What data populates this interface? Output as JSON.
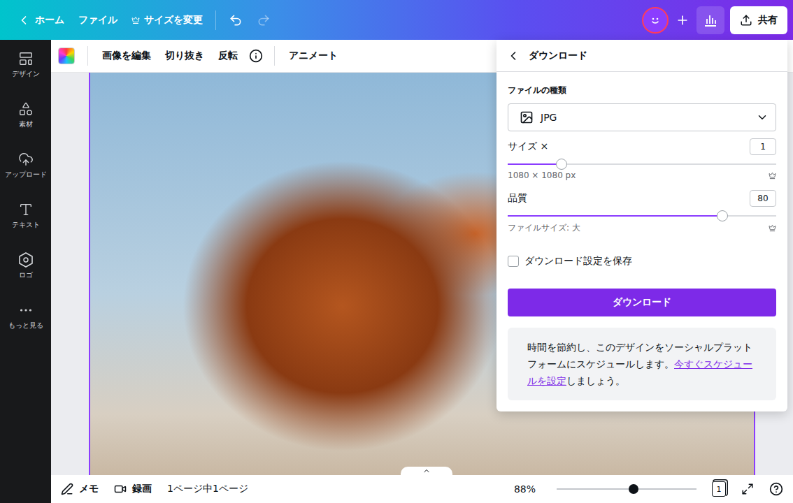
{
  "top_bar": {
    "home": "ホーム",
    "file": "ファイル",
    "resize": "サイズを変更",
    "redo_disabled": true,
    "share": "共有"
  },
  "sidebar": {
    "items": [
      {
        "label": "デザイン"
      },
      {
        "label": "素材"
      },
      {
        "label": "アップロード"
      },
      {
        "label": "テキスト"
      },
      {
        "label": "ロゴ"
      },
      {
        "label": "もっと見る"
      }
    ]
  },
  "toolbar": {
    "items": [
      "画像を編集",
      "切り抜き",
      "反転"
    ],
    "animate": "アニメート"
  },
  "download_panel": {
    "title": "ダウンロード",
    "file_type_label": "ファイルの種類",
    "file_type": "JPG",
    "size": {
      "label": "サイズ ×",
      "value": "1",
      "level": 0.2,
      "note": "1080 × 1080 px"
    },
    "quality": {
      "label": "品質",
      "value": "80",
      "level": 0.8,
      "note": "ファイルサイズ: 大"
    },
    "save_settings": {
      "label": "ダウンロード設定を保存",
      "checked": false
    },
    "button": "ダウンロード",
    "promo": {
      "text": "時間を節約し、このデザインをソーシャルプラットフォームにスケジュールします。",
      "link": "今すぐスケジュールを設定",
      "suffix": "しましょう。"
    }
  },
  "bottom_bar": {
    "notes": "メモ",
    "record": "録画",
    "page_info": "1ページ中1ページ",
    "zoom": "88%",
    "zoom_level": 0.55,
    "page_count": "1"
  }
}
